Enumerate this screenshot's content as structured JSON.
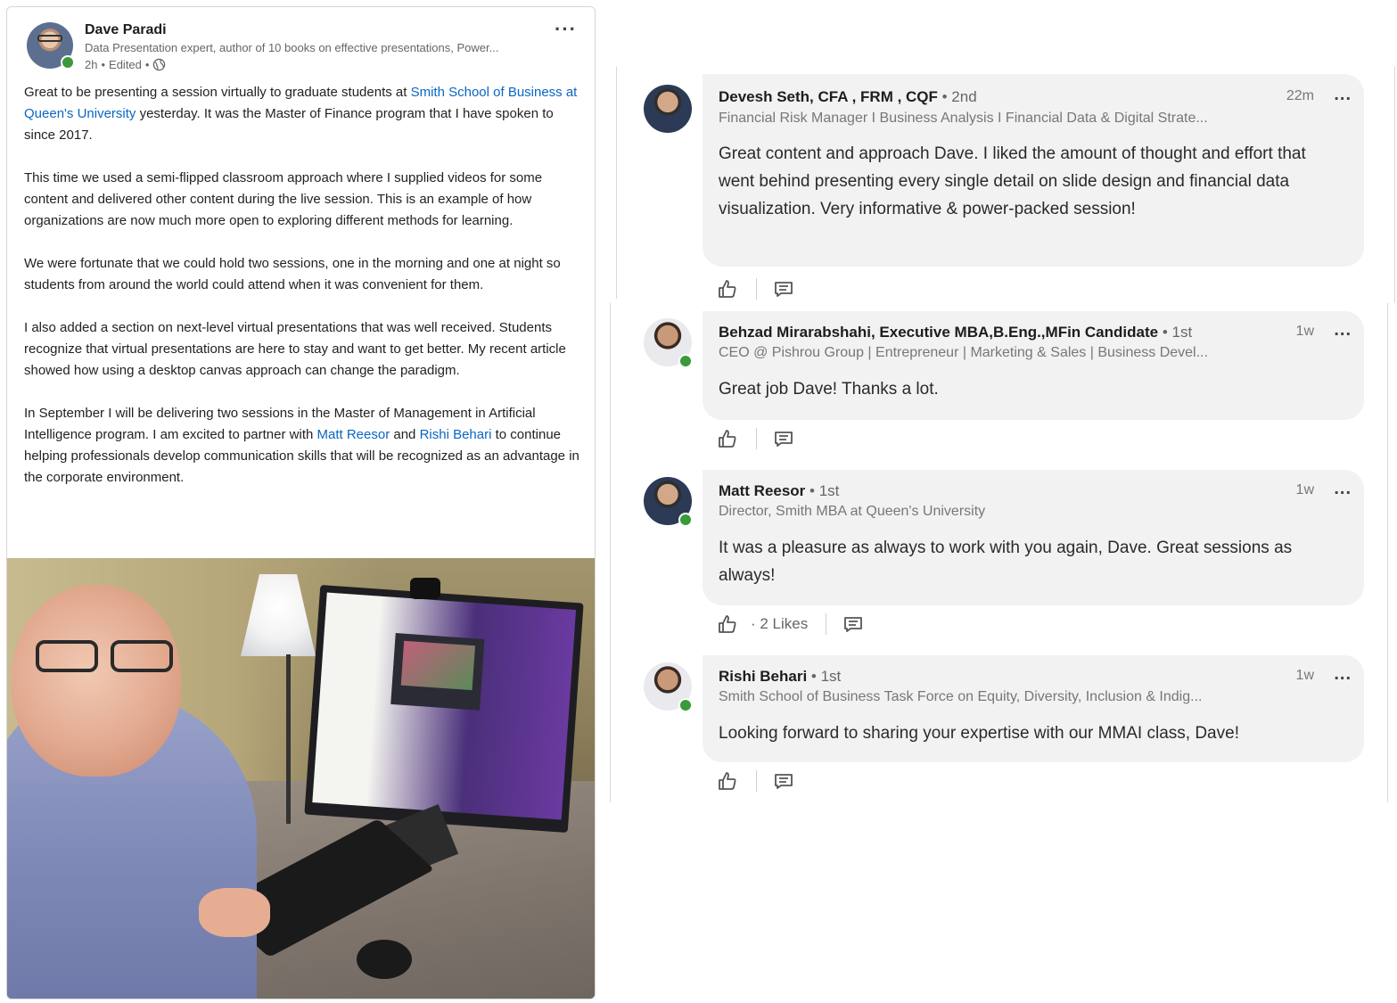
{
  "post": {
    "author_name": "Dave Paradi",
    "author_headline": "Data Presentation expert, author of 10 books on effective presentations, Power...",
    "time": "2h",
    "edited": "Edited",
    "more_label": "···",
    "p1_a": "Great to be presenting a session virtually to graduate students at ",
    "p1_link": "Smith School of Business at Queen's University",
    "p1_b": " yesterday. It was the Master of Finance program that I have spoken to since 2017.",
    "p2": "This time we used a semi-flipped classroom approach where I supplied videos for some content and delivered other content during the live session. This is an example of how organizations are now much more open to exploring different methods for learning.",
    "p3": "We were fortunate that we could hold two sessions, one in the morning and one at night so students from around the world could attend when it was convenient for them.",
    "p4": "I also added a section on next-level virtual presentations that was well received. Students recognize that virtual presentations are here to stay and want to get better. My recent article showed how using a desktop canvas approach can change the paradigm.",
    "p5_a": "In September I will be delivering two sessions in the Master of Management in Artificial Intelligence program. I am excited to partner with ",
    "p5_link1": "Matt Reesor",
    "p5_and": " and ",
    "p5_link2": "Rishi Behari",
    "p5_b": " to continue helping professionals develop communication skills that will be recognized as an advantage in the corporate environment."
  },
  "comments": [
    {
      "name": "Devesh Seth, CFA , FRM , CQF",
      "degree": " • 2nd",
      "headline": "Financial Risk Manager I Business Analysis I Financial Data & Digital Strate...",
      "time": "22m",
      "more": "...",
      "text": "Great content and approach Dave. I liked the amount of thought and effort that went behind presenting every single detail on slide design and financial data visualization. Very informative & power-packed session!"
    },
    {
      "name": "Behzad Mirarabshahi, Executive MBA,B.Eng.,MFin Candidate",
      "degree": " • 1st",
      "headline": "CEO @ Pishrou Group | Entrepreneur | Marketing & Sales | Business Devel...",
      "time": "1w",
      "more": "...",
      "text": "Great job Dave! Thanks a lot."
    },
    {
      "name": "Matt Reesor",
      "degree": " • 1st",
      "headline": "Director, Smith MBA at Queen's University",
      "time": "1w",
      "more": "...",
      "text": "It was a pleasure as always to work with you again, Dave. Great sessions as always!",
      "likes": "· 2 Likes"
    },
    {
      "name": "Rishi Behari",
      "degree": " • 1st",
      "headline": "Smith School of Business Task Force on Equity, Diversity, Inclusion & Indig...",
      "time": "1w",
      "more": "...",
      "text": "Looking forward to sharing your expertise with our MMAI class, Dave!"
    }
  ],
  "icons": {
    "like": "thumbs-up-icon",
    "reply": "comment-icon",
    "visibility": "globe-icon",
    "more": "more-options-icon"
  },
  "colors": {
    "link": "#0a66c2",
    "online": "#3a9a3a",
    "bubble": "#f2f2f2"
  }
}
